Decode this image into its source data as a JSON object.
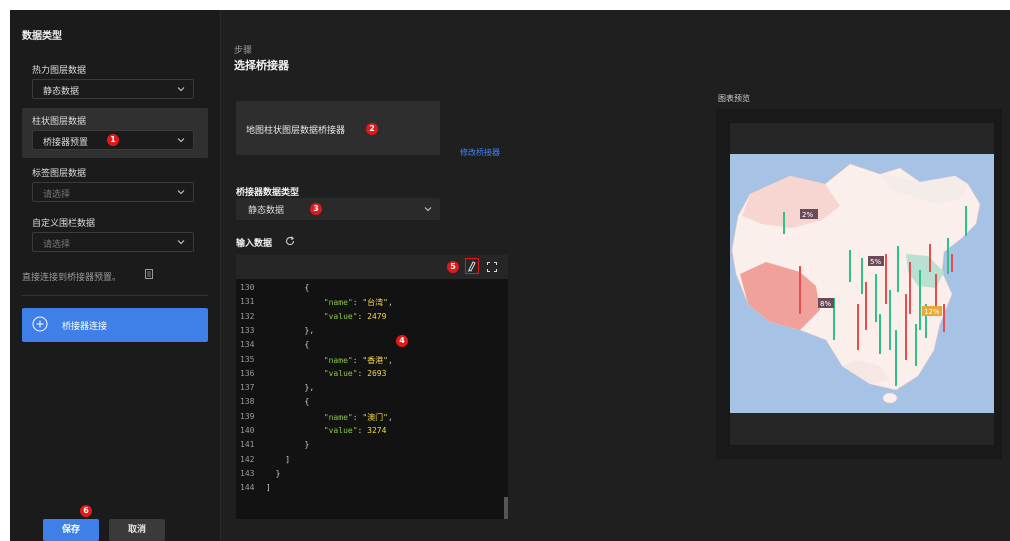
{
  "sidebar": {
    "title": "数据类型",
    "groups": [
      {
        "label": "热力图层数据",
        "value": "静态数据",
        "placeholder": false
      },
      {
        "label": "柱状图层数据",
        "value": "桥接器预置",
        "placeholder": false,
        "badge": "1"
      },
      {
        "label": "标签图层数据",
        "value": "请选择",
        "placeholder": true
      },
      {
        "label": "自定义围栏数据",
        "value": "请选择",
        "placeholder": true
      }
    ],
    "direct_text": "直接连接到桥接器预置。",
    "connect_label": "桥接器连接",
    "save_label": "保存",
    "cancel_label": "取消",
    "save_badge": "6"
  },
  "main": {
    "step_label": "步骤",
    "step_title": "选择桥接器",
    "connector_name": "地图柱状图层数据桥接器",
    "connector_badge": "2",
    "modify_link": "修改桥接器",
    "data_type_label": "桥接器数据类型",
    "data_type_value": "静态数据",
    "data_type_badge": "3",
    "input_label": "输入数据",
    "format_badge": "5",
    "editor_badge": "4",
    "code_lines": [
      {
        "n": "130",
        "indent": "        ",
        "t": "{"
      },
      {
        "n": "131",
        "indent": "            ",
        "key": "\"name\"",
        "sep": ": ",
        "str": "\"台湾\"",
        "end": ","
      },
      {
        "n": "132",
        "indent": "            ",
        "key": "\"value\"",
        "sep": ": ",
        "num": "2479"
      },
      {
        "n": "133",
        "indent": "        ",
        "t": "},"
      },
      {
        "n": "134",
        "indent": "        ",
        "t": "{"
      },
      {
        "n": "135",
        "indent": "            ",
        "key": "\"name\"",
        "sep": ": ",
        "str": "\"香港\"",
        "end": ","
      },
      {
        "n": "136",
        "indent": "            ",
        "key": "\"value\"",
        "sep": ": ",
        "num": "2693"
      },
      {
        "n": "137",
        "indent": "        ",
        "t": "},"
      },
      {
        "n": "138",
        "indent": "        ",
        "t": "{"
      },
      {
        "n": "139",
        "indent": "            ",
        "key": "\"name\"",
        "sep": ": ",
        "str": "\"澳门\"",
        "end": ","
      },
      {
        "n": "140",
        "indent": "            ",
        "key": "\"value\"",
        "sep": ": ",
        "num": "3274"
      },
      {
        "n": "141",
        "indent": "        ",
        "t": "}"
      },
      {
        "n": "142",
        "indent": "    ",
        "t": "]"
      },
      {
        "n": "143",
        "indent": "  ",
        "t": "}"
      },
      {
        "n": "144",
        "indent": "",
        "t": "]"
      }
    ]
  },
  "preview": {
    "label": "图表预览",
    "tags": [
      "2%",
      "5%",
      "8%",
      "12%"
    ],
    "colors": {
      "sea": "#a6c3e6",
      "bar_up": "#2ec28a",
      "bar_down": "#e84c4c",
      "land": "#fbefec",
      "land_red": "#f0a29a"
    }
  },
  "colors": {
    "accent": "#3e7fe8",
    "badge": "#e01a1a",
    "panel": "#1f1f1f"
  }
}
